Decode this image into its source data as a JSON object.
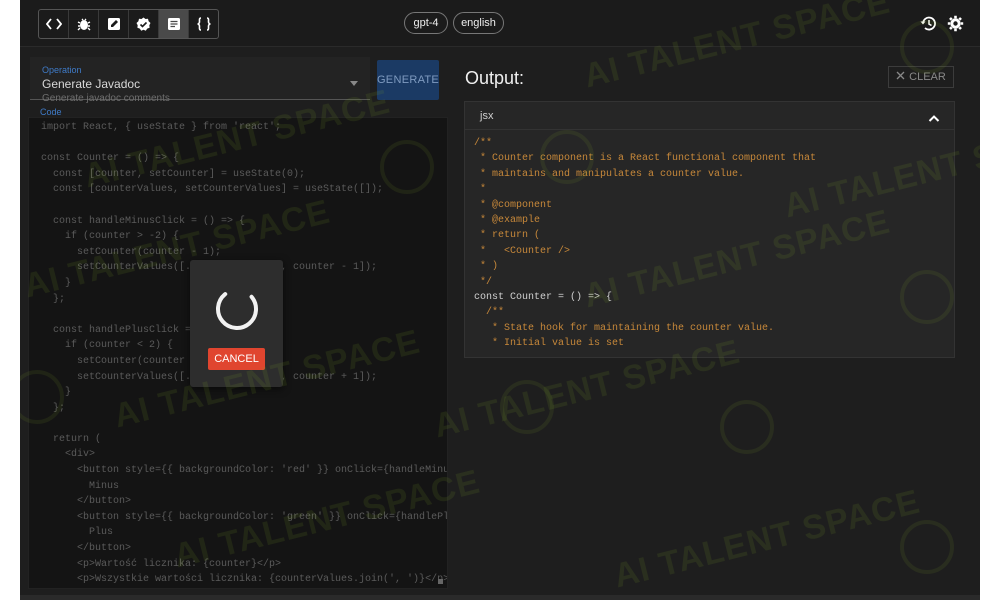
{
  "toolbar": {
    "tools": [
      {
        "icon": "code-brackets-icon"
      },
      {
        "icon": "bug-icon"
      },
      {
        "icon": "edit-icon"
      },
      {
        "icon": "verified-check-icon"
      },
      {
        "icon": "document-icon",
        "active": true
      },
      {
        "icon": "curly-braces-icon"
      }
    ],
    "model": "gpt-4",
    "language": "english",
    "history_icon": "history-icon",
    "settings_icon": "gear-icon"
  },
  "operation": {
    "label": "Operation",
    "value": "Generate Javadoc",
    "description": "Generate javadoc comments"
  },
  "generate_label": "GENERATE",
  "code": {
    "label": "Code",
    "lines": [
      "import React, { useState } from 'react';",
      "",
      "const Counter = () => {",
      "  const [counter, setCounter] = useState(0);",
      "  const [counterValues, setCounterValues] = useState([]);",
      "",
      "  const handleMinusClick = () => {",
      "    if (counter > -2) {",
      "      setCounter(counter - 1);",
      "      setCounterValues([...counterValues, counter - 1]);",
      "    }",
      "  };",
      "",
      "  const handlePlusClick = () => {",
      "    if (counter < 2) {",
      "      setCounter(counter + 1);",
      "      setCounterValues([...counterValues, counter + 1]);",
      "    }",
      "  };",
      "",
      "  return (",
      "    <div>",
      "      <button style={{ backgroundColor: 'red' }} onClick={handleMinus",
      "        Minus",
      "      </button>",
      "      <button style={{ backgroundColor: 'green' }} onClick={handlePlu",
      "        Plus",
      "      </button>",
      "      <p>Wartość licznika: {counter}</p>",
      "      <p>Wszystkie wartości licznika: {counterValues.join(', ')}</p>"
    ]
  },
  "loading": {
    "cancel_label": "CANCEL"
  },
  "output": {
    "title": "Output:",
    "clear_label": "CLEAR",
    "language": "jsx",
    "lines": [
      "/**",
      " * Counter component is a React functional component that",
      " * maintains and manipulates a counter value.",
      " *",
      " * @component",
      " * @example",
      " * return (",
      " *   <Counter />",
      " * )",
      " */",
      "const Counter = () => {",
      "  /**",
      "   * State hook for maintaining the counter value.",
      "   * Initial value is set"
    ]
  },
  "watermark": "AI TALENT SPACE",
  "colors": {
    "background": "#1e1e1e",
    "accent": "#3f7bc8",
    "cancel": "#e0452f",
    "comment": "#c7883a"
  }
}
